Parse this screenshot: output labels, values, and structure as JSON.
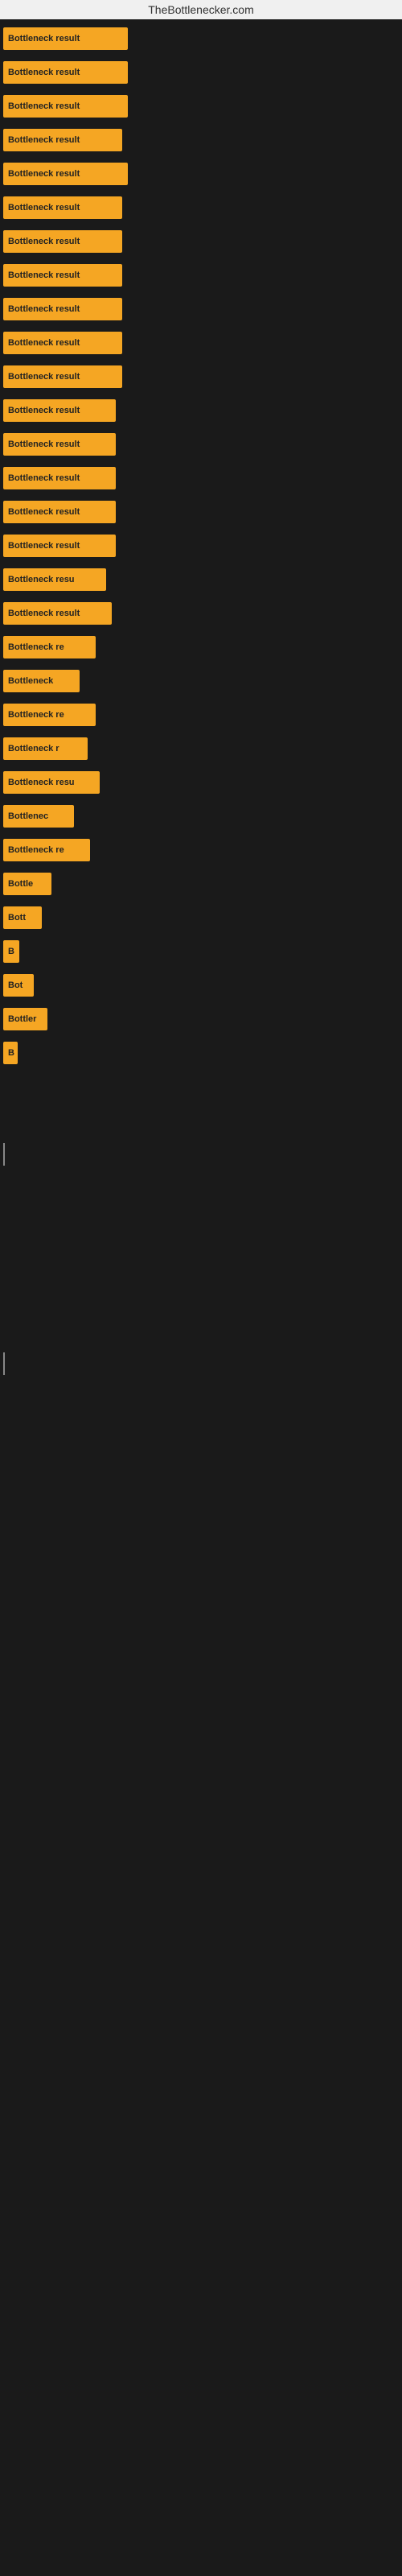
{
  "site": {
    "title": "TheBottlenecker.com"
  },
  "bars": [
    {
      "label": "Bottleneck result",
      "width": 155
    },
    {
      "label": "Bottleneck result",
      "width": 155
    },
    {
      "label": "Bottleneck result",
      "width": 155
    },
    {
      "label": "Bottleneck result",
      "width": 148
    },
    {
      "label": "Bottleneck result",
      "width": 155
    },
    {
      "label": "Bottleneck result",
      "width": 148
    },
    {
      "label": "Bottleneck result",
      "width": 148
    },
    {
      "label": "Bottleneck result",
      "width": 148
    },
    {
      "label": "Bottleneck result",
      "width": 148
    },
    {
      "label": "Bottleneck result",
      "width": 148
    },
    {
      "label": "Bottleneck result",
      "width": 148
    },
    {
      "label": "Bottleneck result",
      "width": 140
    },
    {
      "label": "Bottleneck result",
      "width": 140
    },
    {
      "label": "Bottleneck result",
      "width": 140
    },
    {
      "label": "Bottleneck result",
      "width": 140
    },
    {
      "label": "Bottleneck result",
      "width": 140
    },
    {
      "label": "Bottleneck resu",
      "width": 128
    },
    {
      "label": "Bottleneck result",
      "width": 135
    },
    {
      "label": "Bottleneck re",
      "width": 115
    },
    {
      "label": "Bottleneck",
      "width": 95
    },
    {
      "label": "Bottleneck re",
      "width": 115
    },
    {
      "label": "Bottleneck r",
      "width": 105
    },
    {
      "label": "Bottleneck resu",
      "width": 120
    },
    {
      "label": "Bottlenec",
      "width": 88
    },
    {
      "label": "Bottleneck re",
      "width": 108
    },
    {
      "label": "Bottle",
      "width": 60
    },
    {
      "label": "Bott",
      "width": 48
    },
    {
      "label": "B",
      "width": 20
    },
    {
      "label": "Bot",
      "width": 38
    },
    {
      "label": "Bottler",
      "width": 55
    },
    {
      "label": "B",
      "width": 18
    },
    {
      "label": "",
      "width": 0
    },
    {
      "label": "",
      "width": 0
    },
    {
      "label": "|",
      "width": 8
    },
    {
      "label": "",
      "width": 0
    },
    {
      "label": "",
      "width": 0
    },
    {
      "label": "",
      "width": 0
    },
    {
      "label": "",
      "width": 0
    },
    {
      "label": "|",
      "width": 8
    }
  ]
}
